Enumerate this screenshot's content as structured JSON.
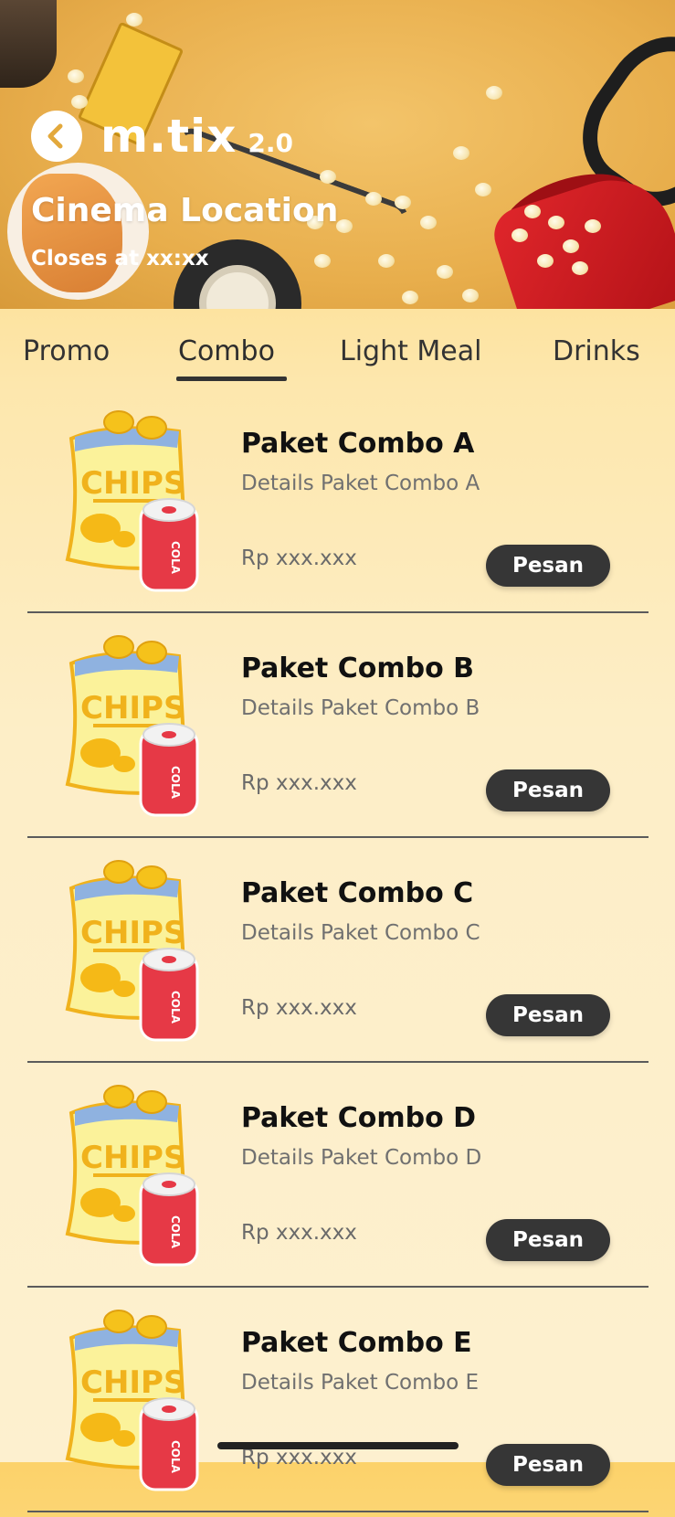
{
  "header": {
    "back_icon": "chevron-left-icon",
    "logo_text": "m.tix",
    "logo_version": "2.0",
    "cinema_title": "Cinema Location",
    "closes_text": "Closes at xx:xx"
  },
  "tabs": [
    {
      "label": "Promo",
      "active": false
    },
    {
      "label": "Combo",
      "active": true
    },
    {
      "label": "Light Meal",
      "active": false
    },
    {
      "label": "Drinks",
      "active": false
    }
  ],
  "items": [
    {
      "name": "Paket Combo A",
      "details": "Details Paket Combo A",
      "price": "Rp xxx.xxx",
      "button": "Pesan"
    },
    {
      "name": "Paket Combo B",
      "details": "Details Paket Combo B",
      "price": "Rp xxx.xxx",
      "button": "Pesan"
    },
    {
      "name": "Paket Combo C",
      "details": "Details Paket Combo C",
      "price": "Rp xxx.xxx",
      "button": "Pesan"
    },
    {
      "name": "Paket Combo D",
      "details": "Details Paket Combo D",
      "price": "Rp xxx.xxx",
      "button": "Pesan"
    },
    {
      "name": "Paket Combo E",
      "details": "Details Paket Combo E",
      "price": "Rp xxx.xxx",
      "button": "Pesan"
    }
  ],
  "colors": {
    "accent_dark": "#363636",
    "background_top": "#fcd26a",
    "background_bottom": "#fdf0cf"
  }
}
